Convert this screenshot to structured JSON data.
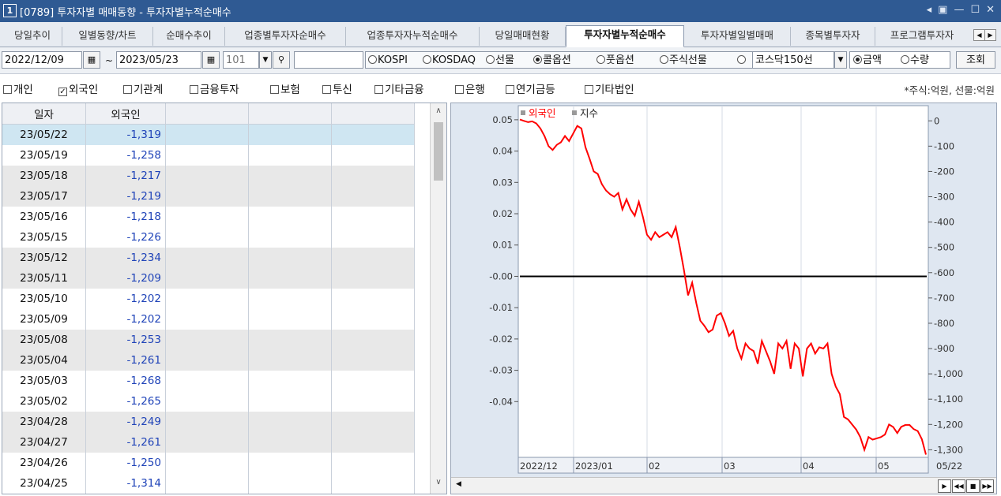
{
  "window": {
    "number": "1",
    "title": "[0789] 투자자별 매매동향 - 투자자별누적순매수"
  },
  "tabs": [
    {
      "label": "당일추이"
    },
    {
      "label": "일별동향/차트"
    },
    {
      "label": "순매수추이"
    },
    {
      "label": "업종별투자자순매수"
    },
    {
      "label": "업종투자자누적순매수"
    },
    {
      "label": "당일매매현황"
    },
    {
      "label": "투자자별누적순매수",
      "active": true
    },
    {
      "label": "투자자별일별매매"
    },
    {
      "label": "종목별투자자"
    },
    {
      "label": "프로그램투자자"
    }
  ],
  "toolbar": {
    "start_date": "2022/12/09",
    "tilde": "~",
    "end_date": "2023/05/23",
    "code": "101",
    "markets": [
      {
        "label": "KOSPI",
        "selected": false
      },
      {
        "label": "KOSDAQ",
        "selected": false
      },
      {
        "label": "선물",
        "selected": false
      },
      {
        "label": "콜옵션",
        "selected": true
      },
      {
        "label": "풋옵션",
        "selected": false
      },
      {
        "label": "주식선물",
        "selected": false
      },
      {
        "label": "",
        "selected": false
      }
    ],
    "index_select": "코스닥150선",
    "amount_label": "금액",
    "quantity_label": "수량",
    "query_button": "조회"
  },
  "filters": [
    {
      "label": "개인",
      "checked": false
    },
    {
      "label": "외국인",
      "checked": true
    },
    {
      "label": "기관계",
      "checked": false
    },
    {
      "label": "금융투자",
      "checked": false
    },
    {
      "label": "보험",
      "checked": false
    },
    {
      "label": "투신",
      "checked": false
    },
    {
      "label": "기타금융",
      "checked": false
    },
    {
      "label": "은행",
      "checked": false
    },
    {
      "label": "연기금등",
      "checked": false
    },
    {
      "label": "기타법인",
      "checked": false
    }
  ],
  "unit_note": "*주식:억원, 선물:억원",
  "table": {
    "headers": [
      "일자",
      "외국인",
      "",
      "",
      ""
    ],
    "rows": [
      {
        "date": "23/05/22",
        "value": "-1,319"
      },
      {
        "date": "23/05/19",
        "value": "-1,258"
      },
      {
        "date": "23/05/18",
        "value": "-1,217"
      },
      {
        "date": "23/05/17",
        "value": "-1,219"
      },
      {
        "date": "23/05/16",
        "value": "-1,218"
      },
      {
        "date": "23/05/15",
        "value": "-1,226"
      },
      {
        "date": "23/05/12",
        "value": "-1,234"
      },
      {
        "date": "23/05/11",
        "value": "-1,209"
      },
      {
        "date": "23/05/10",
        "value": "-1,202"
      },
      {
        "date": "23/05/09",
        "value": "-1,202"
      },
      {
        "date": "23/05/08",
        "value": "-1,253"
      },
      {
        "date": "23/05/04",
        "value": "-1,261"
      },
      {
        "date": "23/05/03",
        "value": "-1,268"
      },
      {
        "date": "23/05/02",
        "value": "-1,265"
      },
      {
        "date": "23/04/28",
        "value": "-1,249"
      },
      {
        "date": "23/04/27",
        "value": "-1,261"
      },
      {
        "date": "23/04/26",
        "value": "-1,250"
      },
      {
        "date": "23/04/25",
        "value": "-1,314"
      }
    ]
  },
  "chart_data": {
    "type": "line",
    "legend": [
      "외국인",
      "지수"
    ],
    "legend_placement": "top-left",
    "left_axis_ticks": [
      "0.05",
      "0.04",
      "0.03",
      "0.02",
      "0.01",
      "-0.00",
      "-0.01",
      "-0.02",
      "-0.03",
      "-0.04"
    ],
    "left_ylim": [
      -0.05,
      0.05
    ],
    "right_axis_ticks": [
      "0",
      "-100",
      "-200",
      "-300",
      "-400",
      "-500",
      "-600",
      "-700",
      "-800",
      "-900",
      "-1,000",
      "-1,100",
      "-1,200",
      "-1,300"
    ],
    "right_ylim": [
      -1330,
      60
    ],
    "x_ticks": [
      "2022/12",
      "2023/01",
      "02",
      "03",
      "04",
      "05"
    ],
    "x_end_label": "05/22",
    "zero_line": -0.0,
    "series": [
      {
        "name": "외국인",
        "color": "#ff0000",
        "axis": "right",
        "values": [
          5,
          0,
          -5,
          -2,
          -10,
          -30,
          -60,
          -100,
          -115,
          -95,
          -85,
          -60,
          -80,
          -50,
          -20,
          -30,
          -105,
          -150,
          -200,
          -210,
          -250,
          -275,
          -290,
          -300,
          -285,
          -350,
          -310,
          -350,
          -375,
          -320,
          -380,
          -450,
          -470,
          -440,
          -460,
          -450,
          -440,
          -460,
          -420,
          -500,
          -590,
          -690,
          -640,
          -720,
          -790,
          -810,
          -835,
          -825,
          -770,
          -760,
          -800,
          -850,
          -830,
          -900,
          -940,
          -880,
          -900,
          -910,
          -960,
          -870,
          -910,
          -950,
          -1000,
          -880,
          -900,
          -870,
          -980,
          -880,
          -900,
          -1010,
          -900,
          -880,
          -920,
          -895,
          -900,
          -880,
          -1000,
          -1050,
          -1080,
          -1170,
          -1180,
          -1200,
          -1220,
          -1250,
          -1300,
          -1250,
          -1260,
          -1255,
          -1250,
          -1240,
          -1200,
          -1210,
          -1234,
          -1209,
          -1202,
          -1202,
          -1218,
          -1226,
          -1258,
          -1319
        ]
      }
    ],
    "colors": {
      "series": "#ff0000",
      "zero_line": "#000000",
      "frame": "#dfe7f1"
    }
  }
}
